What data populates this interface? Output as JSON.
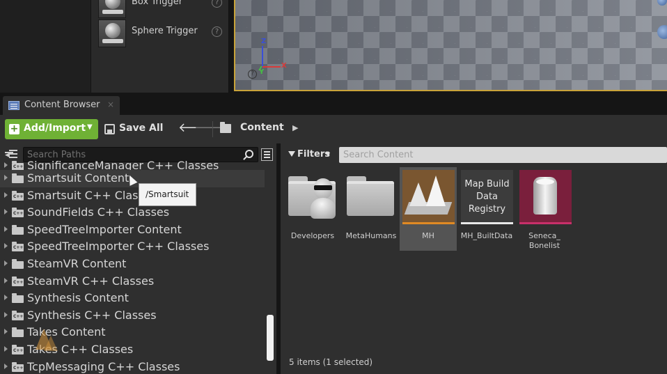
{
  "place_panel": {
    "items": [
      {
        "label": "Box Trigger"
      },
      {
        "label": "Sphere Trigger"
      }
    ]
  },
  "viewport": {
    "axis_z": "Z",
    "axis_x": "X",
    "axis_y": "Y"
  },
  "tab": {
    "label": "Content Browser",
    "close": "×"
  },
  "toolbar": {
    "add_import": "Add/Import",
    "save_all": "Save All",
    "breadcrumb": "Content"
  },
  "paths": {
    "search_placeholder": "Search Paths",
    "items": [
      {
        "label": "SignificanceManager C++ Classes",
        "type": "cpp"
      },
      {
        "label": "Smartsuit Content",
        "type": "folder"
      },
      {
        "label": "Smartsuit C++ Classes",
        "type": "cpp"
      },
      {
        "label": "SoundFields C++ Classes",
        "type": "cpp"
      },
      {
        "label": "SpeedTreeImporter Content",
        "type": "folder"
      },
      {
        "label": "SpeedTreeImporter C++ Classes",
        "type": "cpp"
      },
      {
        "label": "SteamVR Content",
        "type": "folder"
      },
      {
        "label": "SteamVR C++ Classes",
        "type": "cpp"
      },
      {
        "label": "Synthesis Content",
        "type": "folder"
      },
      {
        "label": "Synthesis C++ Classes",
        "type": "cpp"
      },
      {
        "label": "Takes Content",
        "type": "folder"
      },
      {
        "label": "Takes C++ Classes",
        "type": "cpp"
      },
      {
        "label": "TcpMessaging C++ Classes",
        "type": "cpp"
      }
    ],
    "tooltip": "/Smartsuit"
  },
  "content": {
    "filters_label": "Filters",
    "search_placeholder": "Search Content",
    "assets": [
      {
        "name": "Developers",
        "kind": "developers-folder"
      },
      {
        "name": "MetaHumans",
        "kind": "folder"
      },
      {
        "name": "MH",
        "kind": "level",
        "selected": true
      },
      {
        "name": "MH_BuiltData",
        "kind": "map-build-data",
        "thumb_text": [
          "Map Build",
          "Data",
          "Registry"
        ]
      },
      {
        "name": "Seneca_ Bonelist",
        "kind": "skeleton"
      }
    ],
    "status": "5 items (1 selected)"
  },
  "colors": {
    "accent_green": "#6fb135",
    "selection_orange": "#e08a24",
    "viewport_border": "#c9a33a"
  }
}
